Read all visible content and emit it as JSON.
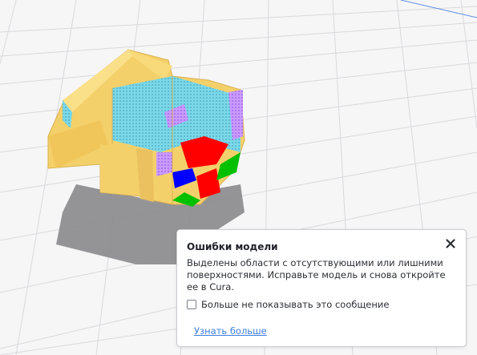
{
  "viewport": {
    "background_color": "#f6f6f7",
    "grid_color": "#d9d9dc",
    "model_color": "#f4d06a",
    "error_colors": [
      "#ff0000",
      "#0000ff",
      "#00c000",
      "#c084fc",
      "#7ad8e8"
    ]
  },
  "dialog": {
    "title": "Ошибки модели",
    "close_icon": "close-icon",
    "body_text": "Выделены области с отсутствующими или лишними поверхностями. Исправьте модель и снова откройте ее в Cura.",
    "checkbox_label": "Больше не показывать это сообщение",
    "checkbox_checked": false,
    "link_text": "Узнать больше",
    "link_color": "#3d7fe0"
  }
}
